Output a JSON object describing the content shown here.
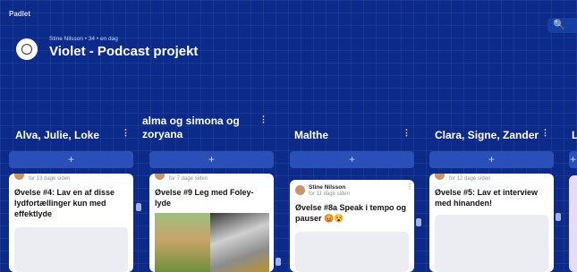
{
  "app": {
    "brand": "Padlet"
  },
  "header": {
    "meta": "Stine Nilsson • 34 • en dag",
    "title": "Violet - Podcast projekt",
    "search_icon": "🔍"
  },
  "columns": [
    {
      "title": "Alva, Julie, Loke",
      "add_label": "+",
      "card": {
        "date": "for 13 dage siden",
        "text": "Øvelse #4: Lav en af disse lydfortællinger kun med effektlyde"
      }
    },
    {
      "title": "alma og simona og zoryana",
      "add_label": "+",
      "card": {
        "date": "for 7 dage siden",
        "text": "Øvelse #9 Leg med Foley-lyde"
      }
    },
    {
      "title": "Malthe",
      "add_label": "+",
      "card": {
        "author": "Stine Nilsson",
        "date": "for 11 dage siden",
        "text": "Øvelse #8a Speak i tempo og pauser 😡😵"
      }
    },
    {
      "title": "Clara, Signe, Zander",
      "add_label": "+",
      "card": {
        "date": "for 12 dage siden",
        "text": "Øvelse #5: Lav et interview med hinanden!"
      }
    },
    {
      "title": "L",
      "add_label": "+"
    }
  ],
  "colors": {
    "background": "#0b2a8a",
    "card": "#ffffff",
    "add_button": "#2a4fb7"
  }
}
